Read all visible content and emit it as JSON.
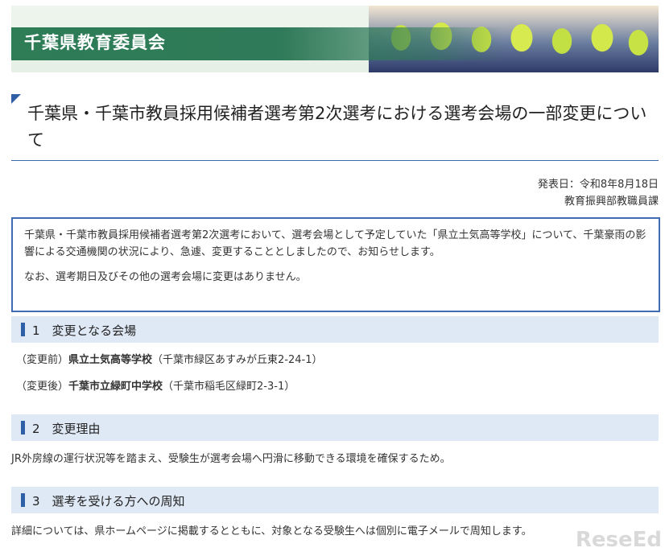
{
  "header": {
    "title": "千葉県教育委員会"
  },
  "page": {
    "heading": "千葉県・千葉市教員採用候補者選考第2次選考における選考会場の一部変更について"
  },
  "meta": {
    "date": "発表日：令和8年8月18日",
    "department": "教育振興部教職員課"
  },
  "notice": {
    "p1": "千葉県・千葉市教員採用候補者選考第2次選考において、選考会場として予定していた「県立土気高等学校」について、千葉豪雨の影響による交通機関の状況により、急遽、変更することとしましたので、お知らせします。",
    "p2": "なお、選考期日及びその他の選考会場に変更はありません。"
  },
  "sections": [
    {
      "title": "1　変更となる会場",
      "lines": [
        {
          "prefix": "（変更前）",
          "strong": "県立土気高等学校",
          "suffix": "（千葉市緑区あすみが丘東2-24-1）"
        },
        {
          "prefix": "（変更後）",
          "strong": "千葉市立緑町中学校",
          "suffix": "（千葉市稲毛区緑町2-3-1）"
        }
      ]
    },
    {
      "title": "2　変更理由",
      "text": "JR外房線の運行状況等を踏まえ、受験生が選考会場へ円滑に移動できる環境を確保するため。"
    },
    {
      "title": "3　選考を受ける方への周知",
      "text": "詳細については、県ホームページに掲載するとともに、対象となる受験生へは個別に電子メールで周知します。"
    }
  ],
  "watermark": {
    "text": "ReseEd"
  }
}
